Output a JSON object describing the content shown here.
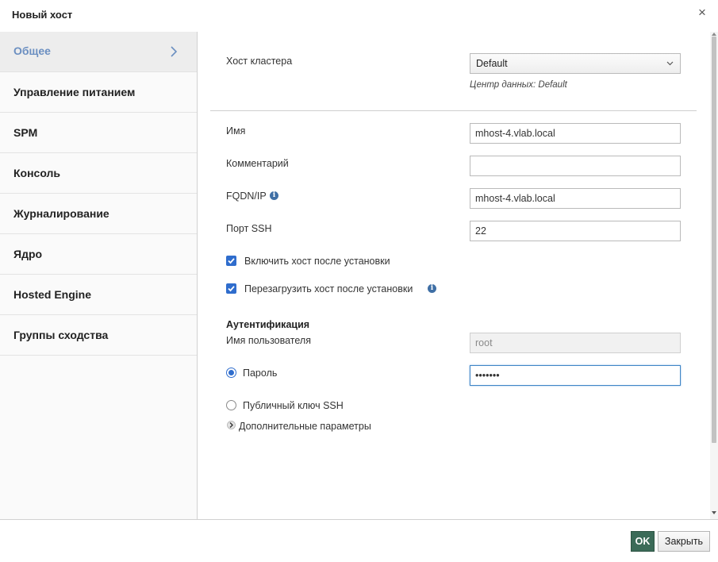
{
  "dialog": {
    "title": "Новый хост",
    "close_glyph": "×"
  },
  "sidebar": {
    "items": [
      {
        "label": "Общее",
        "active": true
      },
      {
        "label": "Управление питанием"
      },
      {
        "label": "SPM"
      },
      {
        "label": "Консоль"
      },
      {
        "label": "Журналирование"
      },
      {
        "label": "Ядро"
      },
      {
        "label": "Hosted Engine"
      },
      {
        "label": "Группы сходства"
      }
    ]
  },
  "general": {
    "cluster_label": "Хост кластера",
    "cluster_value": "Default",
    "datacenter_hint": "Центр данных: Default",
    "name_label": "Имя",
    "name_value": "mhost-4.vlab.local",
    "comment_label": "Комментарий",
    "comment_value": "",
    "fqdn_label": "FQDN/IP",
    "fqdn_value": "mhost-4.vlab.local",
    "ssh_port_label": "Порт SSH",
    "ssh_port_value": "22",
    "activate_label": "Включить хост после установки",
    "activate_checked": true,
    "reboot_label": "Перезагрузить хост после установки",
    "reboot_checked": true
  },
  "auth": {
    "section_title": "Аутентификация",
    "username_label": "Имя пользователя",
    "username_value": "root",
    "password_label": "Пароль",
    "password_value": "•••••••",
    "ssh_key_label": "Публичный ключ SSH",
    "selected": "password"
  },
  "advanced_label": "Дополнительные параметры",
  "footer": {
    "ok_label": "OK",
    "close_label": "Закрыть"
  },
  "colors": {
    "accent": "#2f6dcd",
    "active_sidebar_text": "#6b8fc1",
    "ok_button": "#3b6b58",
    "info_icon": "#3f6fa5"
  },
  "icons": {
    "close": "close-icon",
    "chevron": "chevron-right-icon",
    "caret": "chevron-down-icon",
    "info": "info-icon",
    "check": "check-icon",
    "expand": "expand-arrow-icon"
  }
}
